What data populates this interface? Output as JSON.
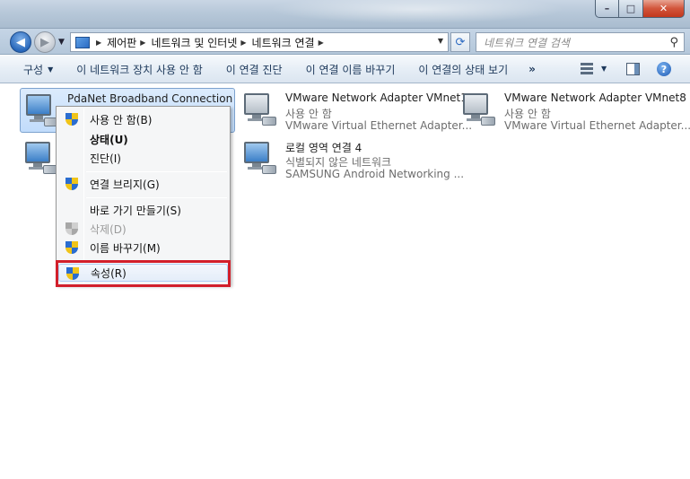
{
  "addressbar": {
    "crumbs": [
      "제어판",
      "네트워크 및 인터넷",
      "네트워크 연결"
    ],
    "search_placeholder": "네트워크 연결 검색"
  },
  "window_buttons": {
    "minimize": "–",
    "maximize": "□",
    "close": "✕"
  },
  "commandbar": {
    "organize": "구성",
    "disable": "이 네트워크 장치 사용 안 함",
    "diagnose": "이 연결 진단",
    "rename": "이 연결 이름 바꾸기",
    "status": "이 연결의 상태 보기",
    "more": "»"
  },
  "connections": [
    {
      "name": "PdaNet Broadband Connection",
      "status": "",
      "device": ""
    },
    {
      "name": "VMware Network Adapter VMnet1",
      "status": "사용 안 함",
      "device": "VMware Virtual Ethernet Adapter..."
    },
    {
      "name": "VMware Network Adapter VMnet8",
      "status": "사용 안 함",
      "device": "VMware Virtual Ethernet Adapter..."
    },
    {
      "name": "로컬 영역 연결 4",
      "status": "식별되지 않은 네트워크",
      "device": "SAMSUNG Android Networking ..."
    }
  ],
  "context_menu": {
    "disable": "사용 안 함(B)",
    "status": "상태(U)",
    "diagnose": "진단(I)",
    "bridge": "연결 브리지(G)",
    "shortcut": "바로 가기 만들기(S)",
    "delete": "삭제(D)",
    "rename": "이름 바꾸기(M)",
    "properties": "속성(R)"
  },
  "colors": {
    "highlight": "#d21f2b",
    "accent": "#2464b8"
  }
}
